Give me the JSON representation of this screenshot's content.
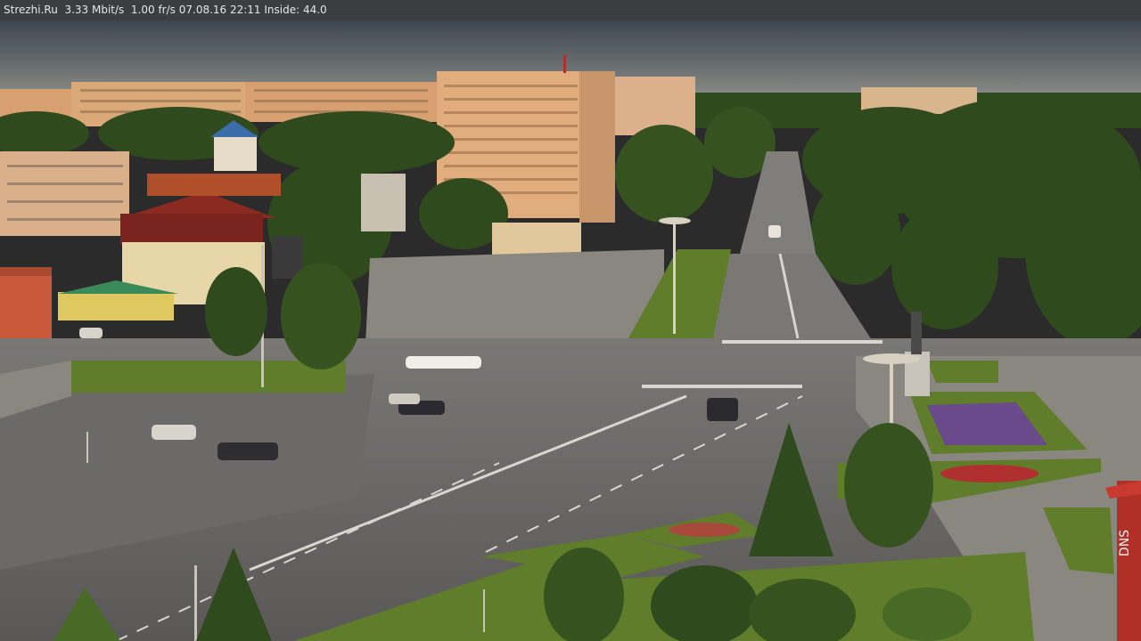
{
  "overlay": {
    "text": "Strezhi.Ru  3.33 Mbit/s  1.00 fr/s 07.08.16 22:11 Inside: 44.0"
  },
  "scene": {
    "description_tag": "webcam-town-square",
    "colors": {
      "sky_top": "#3d4650",
      "sky_bottom": "#8c8e88",
      "asphalt": "#6b6a68",
      "asphalt_dark": "#5d5c5a",
      "plaza": "#8a8680",
      "grass": "#5f7d2a",
      "tree_dark": "#2f4a1c",
      "tree_mid": "#476a26",
      "building_warm": "#d8a070",
      "building_light": "#e7c497",
      "roof_red": "#8a2a20",
      "flowers_purple": "#6a4a8a",
      "flowers_red": "#b03030"
    },
    "shop_sign": "DNS"
  }
}
